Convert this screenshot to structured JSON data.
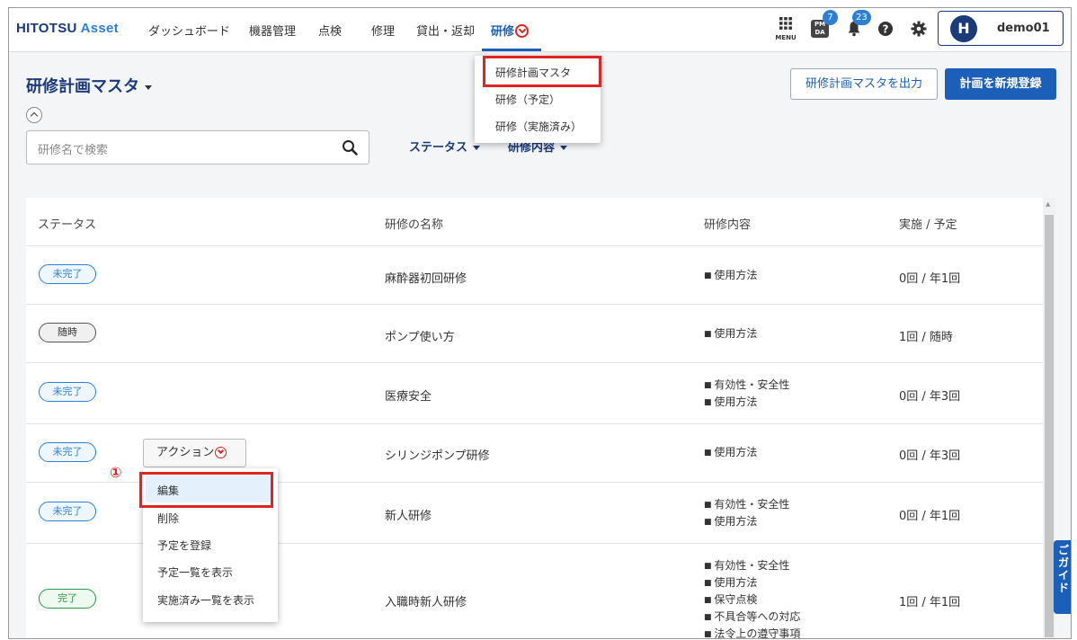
{
  "app": {
    "logo_main": "HITOTSU",
    "logo_accent": "Asset"
  },
  "nav": {
    "dashboard": "ダッシュボード",
    "equipment": "機器管理",
    "inspection": "点検",
    "repair": "修理",
    "lending": "貸出・返却",
    "training": "研修"
  },
  "header": {
    "menu_label": "MENU",
    "pmda_label": "PM DA",
    "pmda_count": "7",
    "notif_count": "23",
    "user_initial": "H",
    "user_name": "demo01"
  },
  "training_menu": {
    "items": [
      "研修計画マスタ",
      "研修（予定）",
      "研修（実施済み）"
    ]
  },
  "page": {
    "title": "研修計画マスタ",
    "export_button": "研修計画マスタを出力",
    "new_button": "計画を新規登録",
    "search_placeholder": "研修名で検索",
    "filter_status": "ステータス",
    "filter_content": "研修内容"
  },
  "table": {
    "headers": [
      "ステータス",
      "研修の名称",
      "研修内容",
      "実施 / 予定"
    ],
    "rows": [
      {
        "status": "未完了",
        "name": "麻酔器初回研修",
        "contents": [
          "使用方法"
        ],
        "count": "0回 / 年1回"
      },
      {
        "status": "随時",
        "name": "ポンプ使い方",
        "contents": [
          "使用方法"
        ],
        "count": "1回 / 随時"
      },
      {
        "status": "未完了",
        "name": "医療安全",
        "contents": [
          "有効性・安全性",
          "使用方法"
        ],
        "count": "0回 / 年3回"
      },
      {
        "status": "未完了",
        "name": "シリンジポンプ研修",
        "contents": [
          "使用方法"
        ],
        "count": "0回 / 年3回"
      },
      {
        "status": "未完了",
        "name": "新人研修",
        "contents": [
          "有効性・安全性",
          "使用方法"
        ],
        "count": "0回 / 年1回"
      },
      {
        "status": "完了",
        "name": "入職時新人研修",
        "contents": [
          "有効性・安全性",
          "使用方法",
          "保守点検",
          "不具合等への対応",
          "法令上の遵守事項"
        ],
        "count": "1回 / 年1回"
      }
    ]
  },
  "action": {
    "button_label": "アクション",
    "annotation": "①",
    "items": [
      "編集",
      "削除",
      "予定を登録",
      "予定一覧を表示",
      "実施済み一覧を表示"
    ]
  },
  "guide_tab": {
    "label": "ご ガ イ ド"
  },
  "colors": {
    "brand": "#1a3a7a",
    "accent": "#1c5fb8",
    "highlight": "#e02424"
  }
}
